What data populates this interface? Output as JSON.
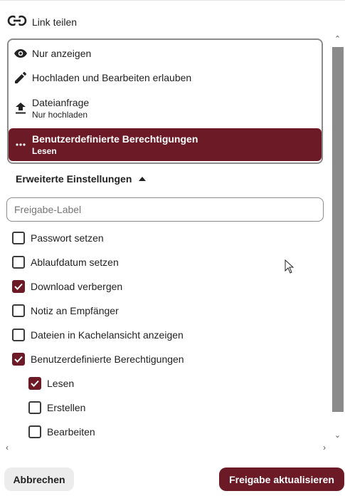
{
  "header": {
    "title": "Link teilen",
    "icon": "link-icon"
  },
  "permissions": [
    {
      "label": "Nur anzeigen",
      "sub": "",
      "icon": "eye-icon",
      "selected": false
    },
    {
      "label": "Hochladen und Bearbeiten erlauben",
      "sub": "",
      "icon": "pencil-icon",
      "selected": false
    },
    {
      "label": "Dateianfrage",
      "sub": "Nur hochladen",
      "icon": "upload-icon",
      "selected": false
    },
    {
      "label": "Benutzerdefinierte Berechtigungen",
      "sub": "Lesen",
      "icon": "more-dots-icon",
      "selected": true
    }
  ],
  "advanced": {
    "label": "Erweiterte Einstellungen",
    "expanded": true
  },
  "share_label": {
    "placeholder": "Freigabe-Label",
    "value": ""
  },
  "options": [
    {
      "label": "Passwort setzen",
      "checked": false
    },
    {
      "label": "Ablaufdatum setzen",
      "checked": false
    },
    {
      "label": "Download verbergen",
      "checked": true
    },
    {
      "label": "Notiz an Empfänger",
      "checked": false
    },
    {
      "label": "Dateien in Kachelansicht anzeigen",
      "checked": false
    },
    {
      "label": "Benutzerdefinierte Berechtigungen",
      "checked": true
    }
  ],
  "custom_permissions": [
    {
      "label": "Lesen",
      "checked": true
    },
    {
      "label": "Erstellen",
      "checked": false
    },
    {
      "label": "Bearbeiten",
      "checked": false
    }
  ],
  "buttons": {
    "cancel": "Abbrechen",
    "submit": "Freigabe aktualisieren"
  },
  "colors": {
    "accent": "#6b1a26",
    "border": "#8b8b8b",
    "scrollbar": "#8a8a8a"
  }
}
